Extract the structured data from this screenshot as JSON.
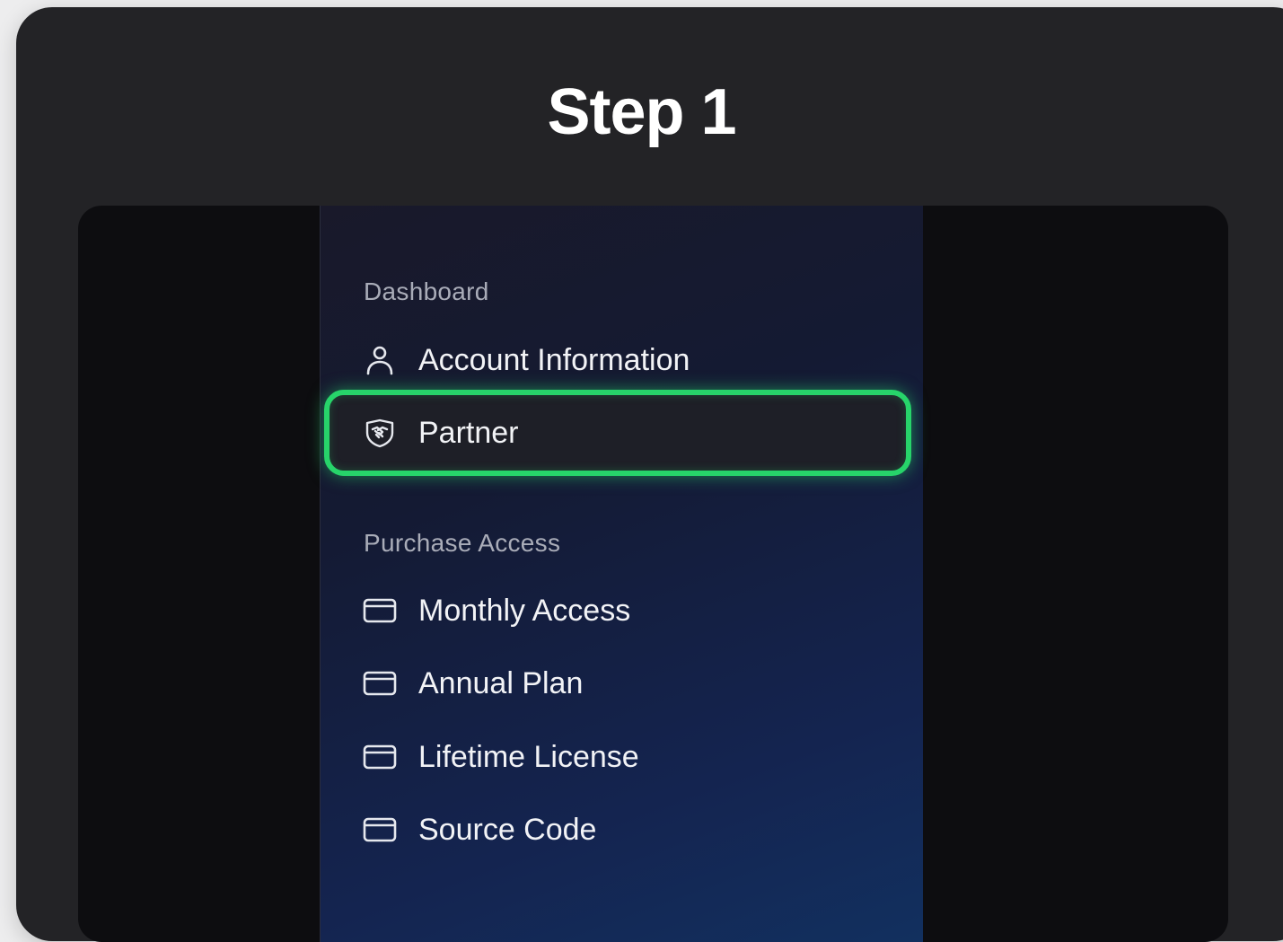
{
  "step": {
    "title": "Step 1"
  },
  "sidebar": {
    "sections": [
      {
        "label": "Dashboard",
        "items": [
          {
            "label": "Account Information",
            "icon": "user-icon"
          },
          {
            "label": "Partner",
            "icon": "handshake-shield-icon",
            "highlighted": true
          }
        ]
      },
      {
        "label": "Purchase Access",
        "items": [
          {
            "label": "Monthly Access",
            "icon": "credit-card-icon"
          },
          {
            "label": "Annual Plan",
            "icon": "credit-card-icon"
          },
          {
            "label": "Lifetime License",
            "icon": "credit-card-icon"
          },
          {
            "label": "Source Code",
            "icon": "credit-card-icon"
          }
        ]
      }
    ]
  },
  "colors": {
    "card_bg": "#232326",
    "highlight": "#27d46a",
    "sidebar_gradient_end": "#12305f"
  }
}
